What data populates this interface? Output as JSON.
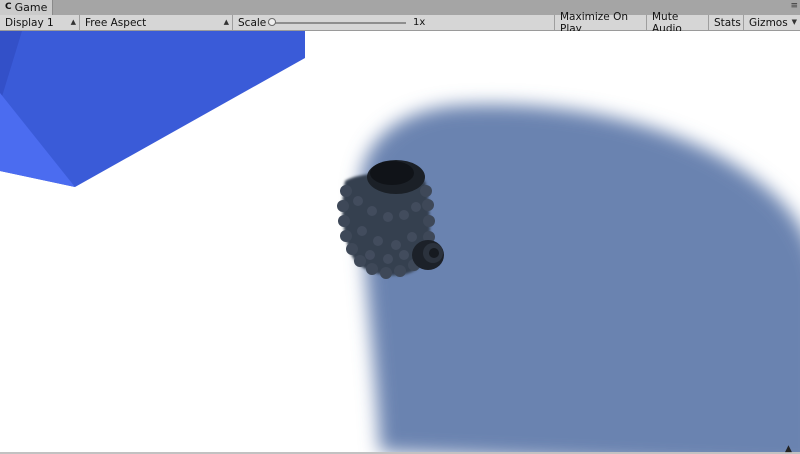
{
  "tab": {
    "label": "Game",
    "glyph": "C",
    "menu_glyph": "≡"
  },
  "toolbar": {
    "display": "Display 1",
    "aspect": "Free Aspect",
    "scale_label": "Scale",
    "scale_value": "1x",
    "maximize_on_play": "Maximize On Play",
    "mute_audio": "Mute Audio",
    "stats": "Stats",
    "gizmos": "Gizmos"
  },
  "colors": {
    "cube_blue": "#3a5bd8",
    "shadow_blue": "#6a83b0",
    "ground": "#ffffff",
    "object_dark": "#333b49"
  }
}
